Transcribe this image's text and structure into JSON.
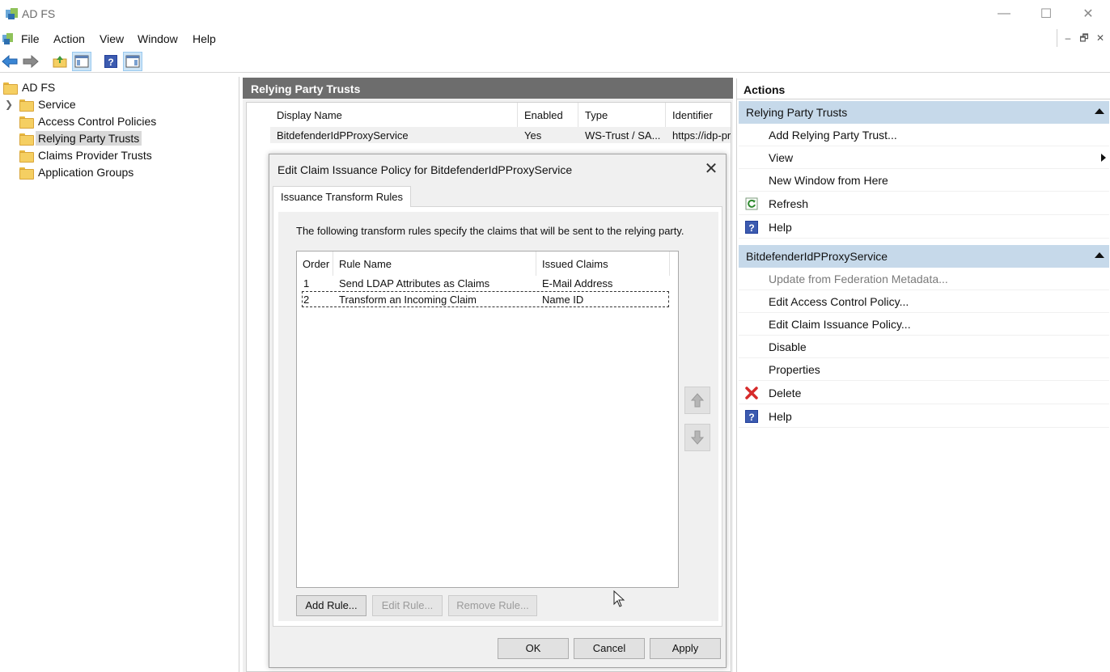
{
  "window": {
    "title": "AD FS",
    "minimize": "—",
    "maximize": "☐",
    "close": "✕"
  },
  "menu": {
    "items": [
      "File",
      "Action",
      "View",
      "Window",
      "Help"
    ],
    "mdi_min": "–",
    "mdi_restore": "🗗",
    "mdi_close": "✕"
  },
  "tree": {
    "root": "AD FS",
    "items": [
      "Service",
      "Access Control Policies",
      "Relying Party Trusts",
      "Claims Provider Trusts",
      "Application Groups"
    ],
    "selected": "Relying Party Trusts"
  },
  "center": {
    "header": "Relying Party Trusts",
    "columns": [
      "Display Name",
      "Enabled",
      "Type",
      "Identifier"
    ],
    "rows": [
      [
        "BitdefenderIdPProxyService",
        "Yes",
        "WS-Trust / SA...",
        "https://idp-pro"
      ]
    ]
  },
  "dialog": {
    "title": "Edit Claim Issuance Policy for BitdefenderIdPProxyService",
    "close": "✕",
    "tab": "Issuance Transform Rules",
    "description": "The following transform rules specify the claims that will be sent to the relying party.",
    "columns": [
      "Order",
      "Rule Name",
      "Issued Claims"
    ],
    "rules": [
      [
        "1",
        "Send LDAP Attributes as Claims",
        "E-Mail Address"
      ],
      [
        "2",
        "Transform an Incoming Claim",
        "Name ID"
      ]
    ],
    "add_rule": "Add Rule...",
    "edit_rule": "Edit Rule...",
    "remove_rule": "Remove Rule...",
    "ok": "OK",
    "cancel": "Cancel",
    "apply": "Apply"
  },
  "actions": {
    "header": "Actions",
    "section1": "Relying Party Trusts",
    "section1_items": [
      "Add Relying Party Trust...",
      "View",
      "New Window from Here",
      "Refresh",
      "Help"
    ],
    "section2": "BitdefenderIdPProxyService",
    "section2_items": [
      "Update from Federation Metadata...",
      "Edit Access Control Policy...",
      "Edit Claim Issuance Policy...",
      "Disable",
      "Properties",
      "Delete",
      "Help"
    ]
  },
  "colors": {
    "section_bg": "#c6d9ea",
    "center_header": "#6d6d6d",
    "selection": "#d9d9d9"
  }
}
